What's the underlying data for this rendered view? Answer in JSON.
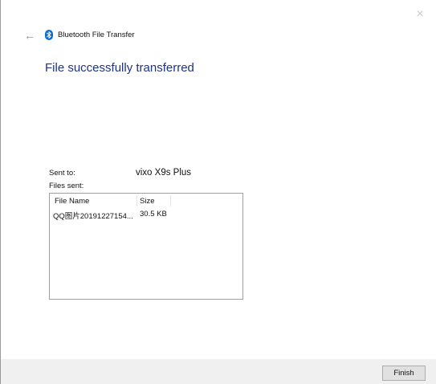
{
  "window": {
    "title": "Bluetooth File Transfer",
    "close_glyph": "×",
    "back_glyph": "←",
    "icons": {
      "app": "bluetooth-icon",
      "back": "back-arrow-icon",
      "close": "close-icon"
    },
    "colors": {
      "heading": "#1e3287",
      "bluetooth": "#0a6fd0",
      "footer": "#f0f0f0"
    }
  },
  "main": {
    "heading": "File successfully transferred",
    "sent_to_label": "Sent to:",
    "sent_to_value": "vixo X9s Plus",
    "files_sent_label": "Files sent:"
  },
  "file_list": {
    "columns": [
      "File Name",
      "Size"
    ],
    "rows": [
      {
        "name": "QQ图片20191227154...",
        "size": "30.5 KB"
      }
    ]
  },
  "footer": {
    "finish_label": "Finish"
  }
}
